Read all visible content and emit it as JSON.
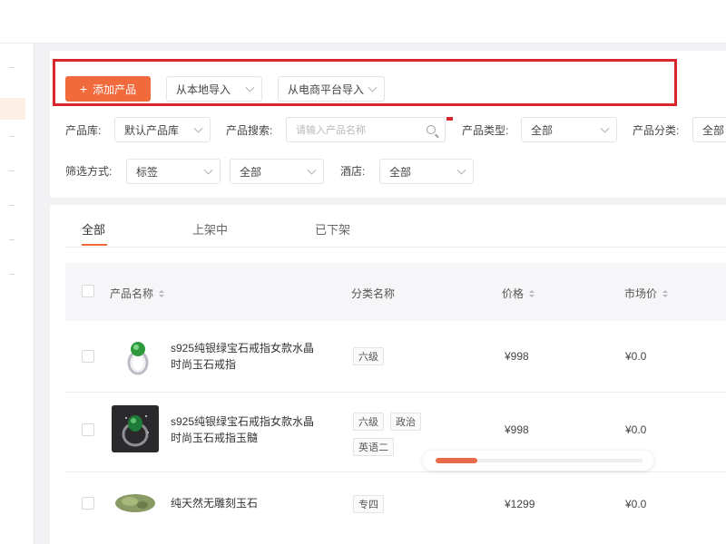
{
  "toolbar": {
    "add_product": "添加产品",
    "import_local": "从本地导入",
    "import_ecommerce": "从电商平台导入"
  },
  "filters": {
    "library_label": "产品库:",
    "library_value": "默认产品库",
    "search_label": "产品搜索:",
    "search_placeholder": "请输入产品名称",
    "type_label": "产品类型:",
    "type_value": "全部",
    "category_label": "产品分类:",
    "category_value": "全部",
    "filter_method_label": "筛选方式:",
    "filter_method_value": "标签",
    "filter_value": "全部",
    "hotel_label": "酒店:",
    "hotel_value": "全部"
  },
  "tabs": [
    "全部",
    "上架中",
    "已下架"
  ],
  "table": {
    "columns": [
      "产品名称",
      "分类名称",
      "价格",
      "市场价"
    ],
    "rows": [
      {
        "name_line1": "s925纯银绿宝石戒指女款水晶",
        "name_line2": "时尚玉石戒指",
        "tags": [
          "六级"
        ],
        "price": "¥998",
        "market_price": "¥0.0"
      },
      {
        "name_line1": "s925纯银绿宝石戒指女款水晶",
        "name_line2": "时尚玉石戒指玉髓",
        "tags": [
          "六级",
          "政治",
          "英语二"
        ],
        "price": "¥998",
        "market_price": "¥0.0"
      },
      {
        "name_line1": "纯天然无雕刻玉石",
        "name_line2": "",
        "tags": [
          "专四"
        ],
        "price": "¥1299",
        "market_price": "¥0.0"
      }
    ]
  },
  "scrollbar": {
    "position_fraction": 0.0,
    "visible_fraction": 0.2
  },
  "colors": {
    "accent": "#f06a3c",
    "highlight": "#d8262d"
  }
}
